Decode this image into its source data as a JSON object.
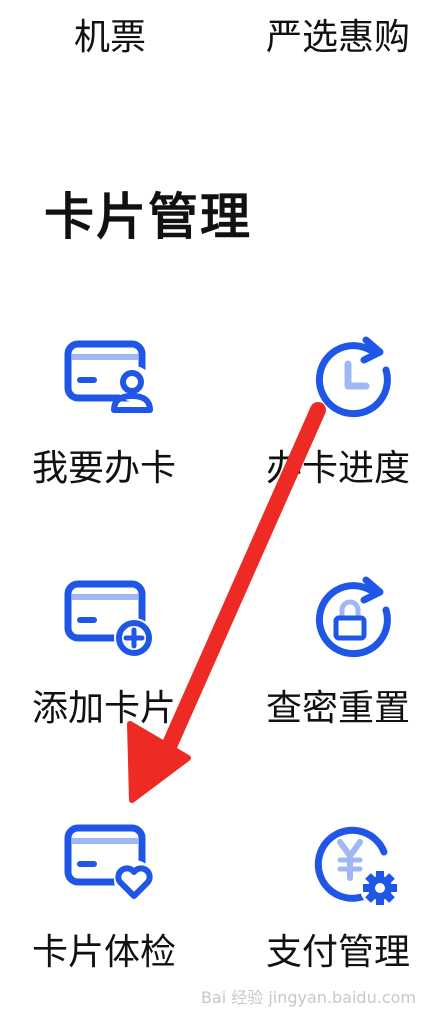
{
  "top_services": {
    "flight": "机票",
    "yanxuan": "严选惠购"
  },
  "section": {
    "title": "卡片管理"
  },
  "tiles": [
    {
      "label": "我要办卡",
      "icon": "card-user-icon"
    },
    {
      "label": "办卡进度",
      "icon": "clock-refresh-icon"
    },
    {
      "label": "添加卡片",
      "icon": "card-add-icon"
    },
    {
      "label": "查密重置",
      "icon": "lock-refresh-icon"
    },
    {
      "label": "卡片体检",
      "icon": "card-heart-icon"
    },
    {
      "label": "支付管理",
      "icon": "yuan-gear-icon"
    }
  ],
  "colors": {
    "accent": "#1f56e8",
    "accent_light": "#9fb8f5",
    "arrow": "#ee2a24"
  },
  "watermark": "Bai 经验 jingyan.baidu.com"
}
